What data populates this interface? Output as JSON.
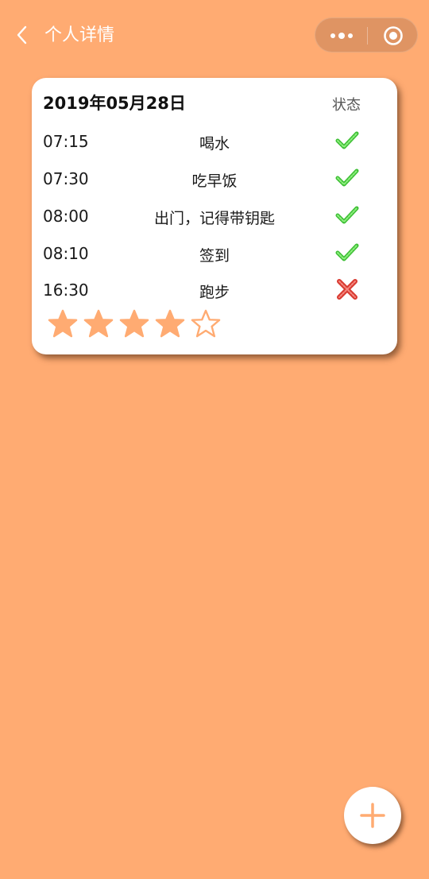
{
  "nav": {
    "title": "个人详情",
    "back_icon": "chevron-left-icon",
    "more_icon": "more-dots-icon",
    "close_icon": "target-circle-icon"
  },
  "card": {
    "date": "2019年05月28日",
    "status_header": "状态",
    "rows": [
      {
        "time": "07:15",
        "task": "喝水",
        "status": "done"
      },
      {
        "time": "07:30",
        "task": "吃早饭",
        "status": "done"
      },
      {
        "time": "08:00",
        "task": "出门，记得带钥匙",
        "status": "done"
      },
      {
        "time": "08:10",
        "task": "签到",
        "status": "done"
      },
      {
        "time": "16:30",
        "task": "跑步",
        "status": "missed"
      }
    ],
    "rating": {
      "value": 4,
      "max": 5
    }
  },
  "fab": {
    "icon": "plus-icon"
  },
  "colors": {
    "background": "#FFAB72",
    "accent": "#FFAB72",
    "done": "#5DE04E",
    "missed": "#E8453C",
    "card": "#FFFFFF"
  }
}
